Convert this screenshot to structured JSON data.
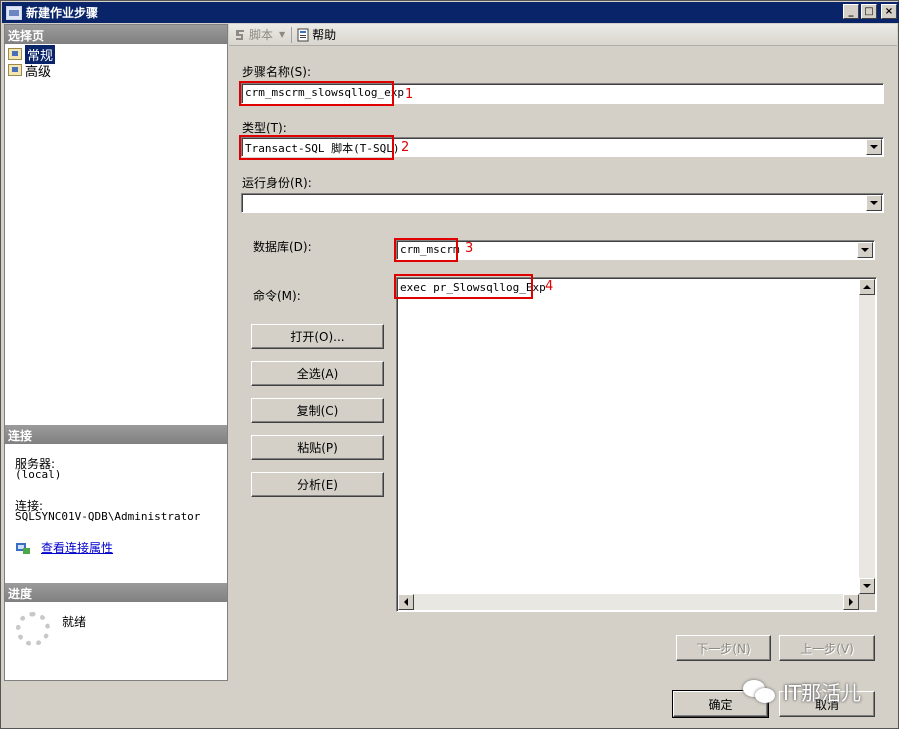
{
  "window": {
    "title": "新建作业步骤",
    "controls": {
      "minimize": "_",
      "maximize": "□",
      "close": "×"
    }
  },
  "left": {
    "select_page_header": "选择页",
    "pages": [
      {
        "label": "常规",
        "selected": true,
        "icon": "page-icon"
      },
      {
        "label": "高级",
        "selected": false,
        "icon": "page-icon"
      }
    ],
    "connection_header": "连接",
    "server_label": "服务器:",
    "server_value": "(local)",
    "connection_label": "连接:",
    "connection_value": "SQLSYNC01V-QDB\\Administrator",
    "view_props_link": "查看连接属性",
    "progress_header": "进度",
    "progress_status": "就绪"
  },
  "toolbar": {
    "script_label": "脚本",
    "help_label": "帮助"
  },
  "form": {
    "step_name_label": "步骤名称(S):",
    "step_name_value": "crm_mscrm_slowsqllog_exp",
    "type_label": "类型(T):",
    "type_value": "Transact-SQL 脚本(T-SQL)",
    "run_as_label": "运行身份(R):",
    "run_as_value": "",
    "database_label": "数据库(D):",
    "database_value": "crm_mscrm",
    "command_label": "命令(M):",
    "command_value": "exec pr_Slowsqllog_Exp",
    "buttons": {
      "open": "打开(O)...",
      "select_all": "全选(A)",
      "copy": "复制(C)",
      "paste": "粘贴(P)",
      "parse": "分析(E)"
    },
    "next": "下一步(N)",
    "prev": "上一步(V)"
  },
  "annotations": [
    "1",
    "2",
    "3",
    "4"
  ],
  "footer": {
    "ok": "确定",
    "cancel": "取消"
  },
  "watermark": "IT那活儿",
  "colors": {
    "titlebar": "#0a246a",
    "section_header": "#808080",
    "annotation_red": "#e00000",
    "dialog_bg": "#d4d0c8"
  }
}
